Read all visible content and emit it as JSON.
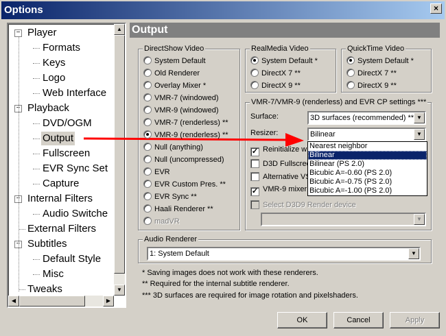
{
  "window": {
    "title": "Options",
    "close": "×"
  },
  "tree": [
    {
      "label": "Player",
      "level": 0
    },
    {
      "label": "Formats",
      "level": 1
    },
    {
      "label": "Keys",
      "level": 1
    },
    {
      "label": "Logo",
      "level": 1
    },
    {
      "label": "Web Interface",
      "level": 1
    },
    {
      "label": "Playback",
      "level": 0
    },
    {
      "label": "DVD/OGM",
      "level": 1
    },
    {
      "label": "Output",
      "level": 1,
      "selected": true
    },
    {
      "label": "Fullscreen",
      "level": 1
    },
    {
      "label": "EVR Sync Set",
      "level": 1
    },
    {
      "label": "Capture",
      "level": 1
    },
    {
      "label": "Internal Filters",
      "level": 0
    },
    {
      "label": "Audio Switche",
      "level": 1
    },
    {
      "label": "External Filters",
      "level": 0,
      "leaf": true
    },
    {
      "label": "Subtitles",
      "level": 0
    },
    {
      "label": "Default Style",
      "level": 1
    },
    {
      "label": "Misc",
      "level": 1
    },
    {
      "label": "Tweaks",
      "level": 0,
      "leaf": true
    }
  ],
  "header": "Output",
  "directshow": {
    "label": "DirectShow Video",
    "options": [
      "System Default",
      "Old Renderer",
      "Overlay Mixer *",
      "VMR-7 (windowed)",
      "VMR-9 (windowed)",
      "VMR-7 (renderless) **",
      "VMR-9 (renderless) **",
      "Null (anything)",
      "Null (uncompressed)",
      "EVR",
      "EVR Custom Pres. **",
      "EVR Sync **",
      "Haali Renderer **",
      "madVR"
    ],
    "selected": 6,
    "disabled": [
      13
    ]
  },
  "realmedia": {
    "label": "RealMedia Video",
    "options": [
      "System Default *",
      "DirectX 7 **",
      "DirectX 9 **"
    ],
    "selected": 0
  },
  "quicktime": {
    "label": "QuickTime Video",
    "options": [
      "System Default *",
      "DirectX 7 **",
      "DirectX 9 **"
    ],
    "selected": 0
  },
  "vmr": {
    "label": "VMR-7/VMR-9 (renderless) and EVR CP settings ***",
    "surface_label": "Surface:",
    "surface_value": "3D surfaces (recommended) **",
    "resizer_label": "Resizer:",
    "resizer_value": "Bilinear",
    "resizer_options": [
      "Nearest neighbor",
      "Bilinear",
      "Bilinear (PS 2.0)",
      "Bicubic A=-0.60 (PS 2.0)",
      "Bicubic A=-0.75 (PS 2.0)",
      "Bicubic A=-1.00 (PS 2.0)"
    ],
    "checks": [
      {
        "label": "Reinitialize wh",
        "checked": true
      },
      {
        "label": "D3D Fullscree",
        "checked": false
      },
      {
        "label": "Alternative VS",
        "checked": false
      },
      {
        "label": "VMR-9 mixer m",
        "checked": true
      }
    ],
    "d3d_device_label": "Select D3D9 Render device"
  },
  "audio": {
    "label": "Audio Renderer",
    "value": "1: System Default"
  },
  "notes": [
    "* Saving images does not work with these renderers.",
    "** Required for the internal subtitle renderer.",
    "*** 3D surfaces are required for image rotation and pixelshaders."
  ],
  "buttons": {
    "ok": "OK",
    "cancel": "Cancel",
    "apply": "Apply"
  },
  "colors": {
    "arrow": "#ff0000",
    "selection": "#0a246a"
  }
}
